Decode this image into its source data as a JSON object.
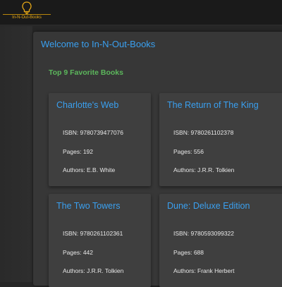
{
  "header": {
    "brand": "In-N-Out-Books",
    "logo_icon": "lightbulb-icon",
    "logo_color": "#e6a817"
  },
  "main": {
    "welcome": "Welcome to In-N-Out-Books",
    "subtitle": "Top 9 Favorite Books",
    "accent": "#3aa0f0",
    "subtitle_color": "#5cb85c"
  },
  "books": [
    {
      "title": "Charlotte's Web",
      "isbn": "ISBN: 9780739477076",
      "pages": "Pages: 192",
      "authors": "Authors: E.B. White"
    },
    {
      "title": "The Return of The King",
      "isbn": "ISBN: 9780261102378",
      "pages": "Pages: 556",
      "authors": "Authors: J.R.R. Tolkien"
    },
    {
      "title": "The Two Towers",
      "isbn": "ISBN: 9780261102361",
      "pages": "Pages: 442",
      "authors": "Authors: J.R.R. Tolkien"
    },
    {
      "title": "Dune: Deluxe Edition",
      "isbn": "ISBN: 9780593099322",
      "pages": "Pages: 688",
      "authors": "Authors: Frank Herbert"
    }
  ]
}
